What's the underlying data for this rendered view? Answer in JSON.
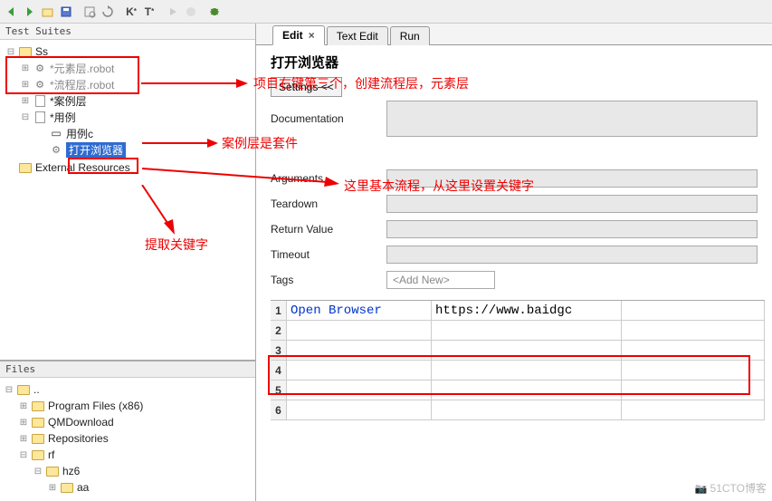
{
  "panels": {
    "test_suites_title": "Test Suites",
    "files_title": "Files"
  },
  "tree": {
    "root": "Ss",
    "items": [
      {
        "label": "*元素层.robot",
        "gray": true
      },
      {
        "label": "*流程层.robot",
        "gray": true
      },
      {
        "label": "*案例层"
      },
      {
        "label": "*用例"
      },
      {
        "label": "用例c"
      },
      {
        "label": "打开浏览器",
        "selected": true
      }
    ],
    "external": "External Resources"
  },
  "files": {
    "root": "..",
    "items": [
      "Program Files (x86)",
      "QMDownload",
      "Repositories",
      "rf",
      "hz6",
      "aa"
    ]
  },
  "tabs": {
    "edit": "Edit",
    "text_edit": "Text Edit",
    "run": "Run"
  },
  "editor": {
    "title": "打开浏览器",
    "settings_btn": "Settings <<",
    "doc_label": "Documentation",
    "args_label": "Arguments",
    "teardown_label": "Teardown",
    "return_label": "Return Value",
    "timeout_label": "Timeout",
    "tags_label": "Tags",
    "add_new": "<Add New>"
  },
  "grid": {
    "rows": [
      {
        "n": "1",
        "c1": "Open Browser",
        "c2": "https://www.baidgc"
      },
      {
        "n": "2",
        "c1": "",
        "c2": ""
      },
      {
        "n": "3",
        "c1": "",
        "c2": ""
      },
      {
        "n": "4",
        "c1": "",
        "c2": ""
      },
      {
        "n": "5",
        "c1": "",
        "c2": ""
      },
      {
        "n": "6",
        "c1": "",
        "c2": ""
      }
    ]
  },
  "annotations": {
    "a1": "项目右键第三个，创建流程层，元素层",
    "a2": "案例层是套件",
    "a3": "这里基本流程，从这里设置关键字",
    "a4": "提取关键字"
  },
  "watermark": "51CTO博客"
}
